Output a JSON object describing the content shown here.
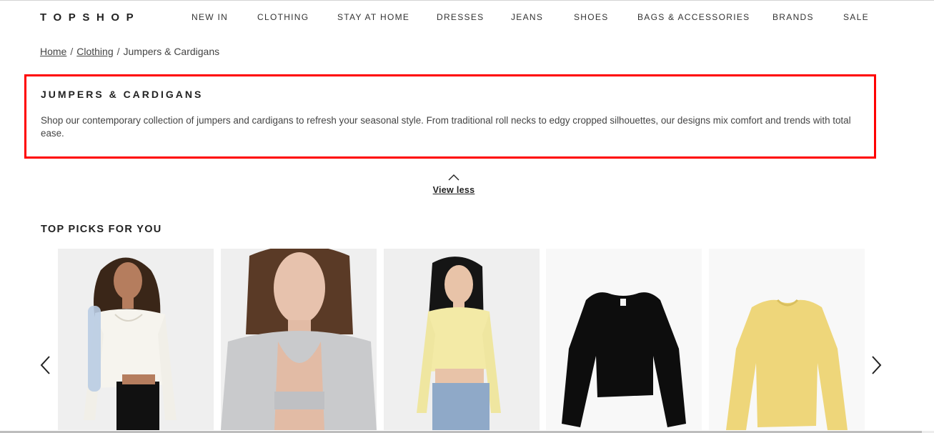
{
  "header": {
    "logo": "TOPSHOP",
    "nav": [
      {
        "label": "NEW IN"
      },
      {
        "label": "CLOTHING"
      },
      {
        "label": "STAY AT HOME"
      },
      {
        "label": "DRESSES"
      },
      {
        "label": "JEANS"
      },
      {
        "label": "SHOES"
      },
      {
        "label": "BAGS & ACCESSORIES"
      },
      {
        "label": "BRANDS"
      },
      {
        "label": "SALE"
      }
    ]
  },
  "breadcrumb": {
    "items": [
      {
        "label": "Home",
        "link": true
      },
      {
        "label": "Clothing",
        "link": true
      },
      {
        "label": "Jumpers & Cardigans",
        "link": false
      }
    ],
    "separator": "/"
  },
  "category": {
    "title": "JUMPERS & CARDIGANS",
    "description": "Shop our contemporary collection of jumpers and cardigans to refresh your seasonal style. From traditional roll necks to edgy cropped silhouettes, our designs mix comfort and trends with total ease.",
    "highlight_color": "#ff0000",
    "toggle_label": "View less",
    "toggle_icon": "chevron-up-icon"
  },
  "top_picks": {
    "title": "TOP PICKS FOR YOU",
    "prev_icon": "chevron-left-icon",
    "next_icon": "chevron-right-icon",
    "products": [
      {
        "image": "model-white-ribbed-cropped-cardigan",
        "garment_color": "#f6f4ee"
      },
      {
        "image": "model-grey-fluffy-cardigan-and-bralette",
        "garment_color": "#c9cacc"
      },
      {
        "image": "model-lemon-ribbed-cropped-cardigan",
        "garment_color": "#f3eaa6"
      },
      {
        "image": "black-wrap-jumper",
        "garment_color": "#0d0d0d"
      },
      {
        "image": "yellow-ribbed-crew-neck-jumper",
        "garment_color": "#eed67a"
      }
    ]
  }
}
